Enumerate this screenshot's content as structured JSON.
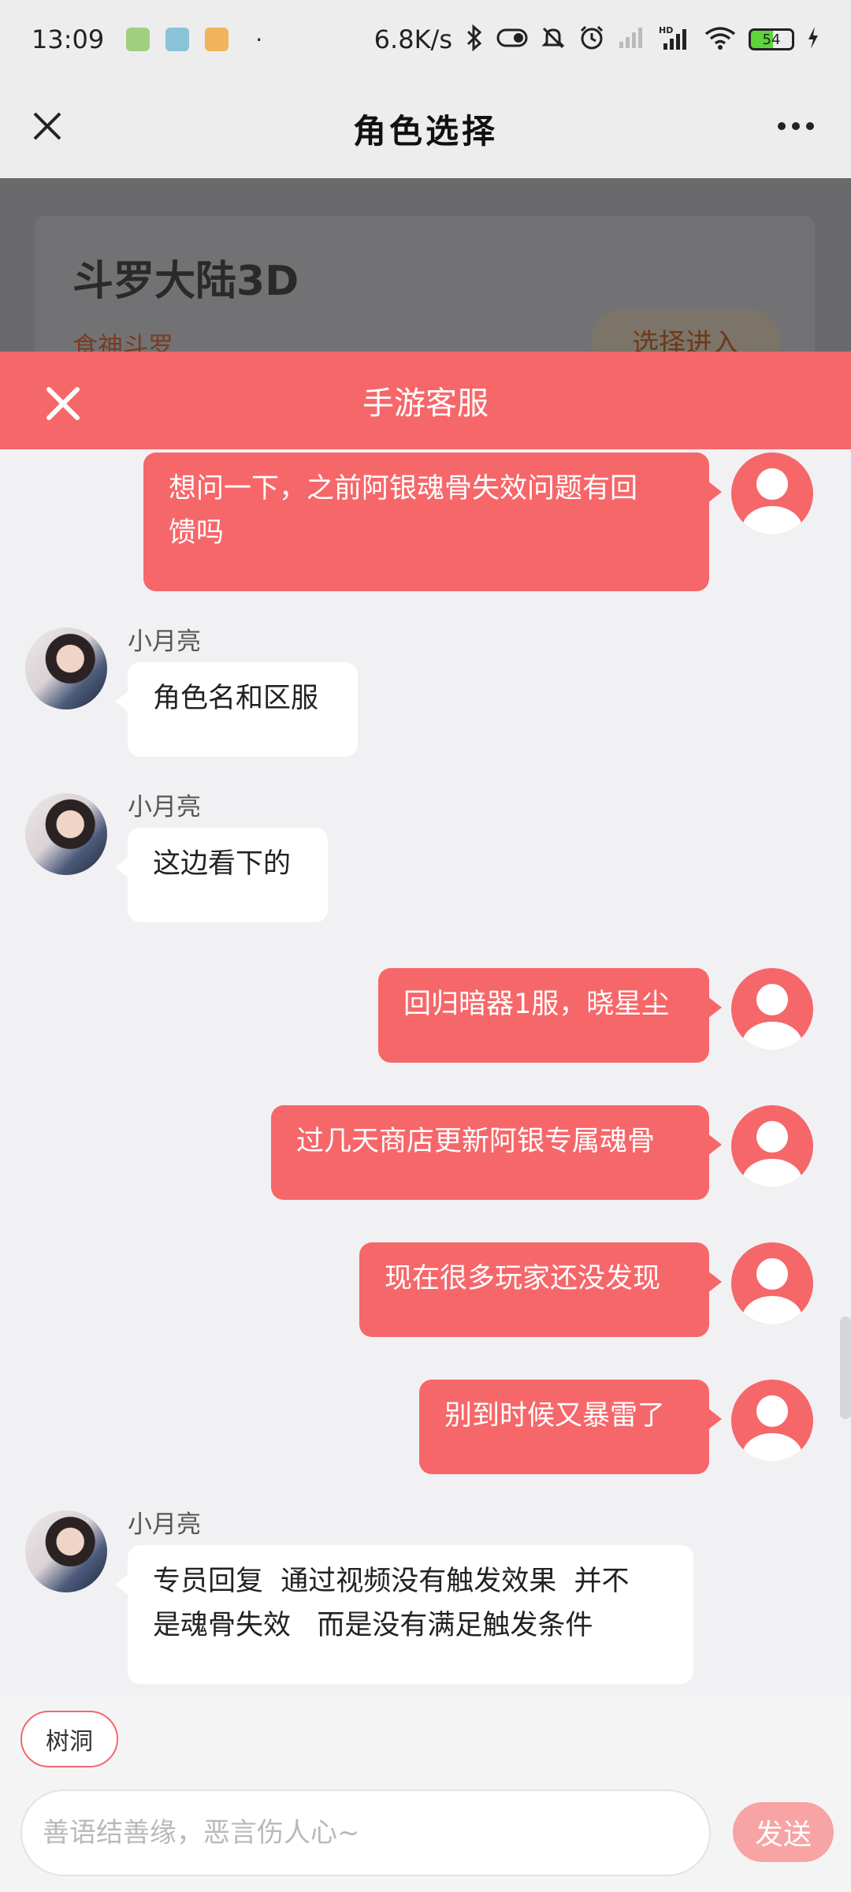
{
  "status_bar": {
    "time": "13:09",
    "dot": "·",
    "net_speed": "6.8K/s",
    "battery": "54",
    "icons": [
      "bluetooth-icon",
      "toggle-icon",
      "mute-icon",
      "alarm-icon",
      "signal-icon",
      "hd-signal-icon",
      "wifi-icon",
      "battery-icon",
      "charging-icon"
    ]
  },
  "nav": {
    "title": "角色选择"
  },
  "background_card": {
    "game_title": "斗罗大陆3D",
    "role_name": "食神斗罗",
    "enter_button": "选择进入"
  },
  "service": {
    "title": "手游客服"
  },
  "messages": [
    {
      "side": "me",
      "text_lines": [
        "想问一下，之前阿银魂骨失效问题有回",
        "馈吗"
      ]
    },
    {
      "side": "other",
      "sender": "小月亮",
      "text_lines": [
        "角色名和区服"
      ]
    },
    {
      "side": "other",
      "sender": "小月亮",
      "text_lines": [
        "这边看下的"
      ]
    },
    {
      "side": "me",
      "text_lines": [
        "回归暗器1服，晓星尘"
      ]
    },
    {
      "side": "me",
      "text_lines": [
        "过几天商店更新阿银专属魂骨"
      ]
    },
    {
      "side": "me",
      "text_lines": [
        "现在很多玩家还没发现"
      ]
    },
    {
      "side": "me",
      "text_lines": [
        "别到时候又暴雷了"
      ]
    },
    {
      "side": "other",
      "sender": "小月亮",
      "text_lines": [
        "专员回复  通过视频没有触发效果  并不",
        "是魂骨失效   而是没有满足触发条件"
      ]
    }
  ],
  "bottom": {
    "tag_label": "树洞",
    "input_placeholder": "善语结善缘，恶言伤人心~",
    "send_label": "发送"
  },
  "colors": {
    "accent": "#f6676a",
    "send_disabled": "#f8a3a4"
  }
}
